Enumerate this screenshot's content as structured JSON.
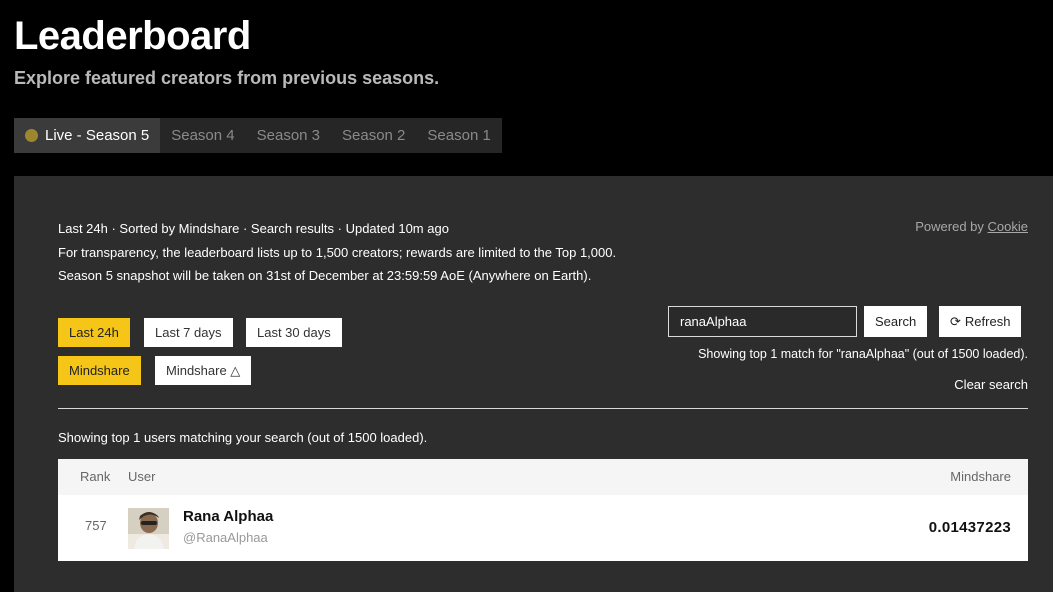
{
  "header": {
    "title": "Leaderboard",
    "subtitle": "Explore featured creators from previous seasons."
  },
  "season_tabs": [
    {
      "label": "Live - Season 5",
      "active": true
    },
    {
      "label": "Season 4",
      "active": false
    },
    {
      "label": "Season 3",
      "active": false
    },
    {
      "label": "Season 2",
      "active": false
    },
    {
      "label": "Season 1",
      "active": false
    }
  ],
  "info": {
    "line1": "Last 24h · Sorted by Mindshare · Search results · Updated 10m ago",
    "line2": "For transparency, the leaderboard lists up to 1,500 creators; rewards are limited to the Top 1,000.",
    "line3": "Season 5 snapshot will be taken on 31st of December at 23:59:59 AoE (Anywhere on Earth)."
  },
  "powered_by": {
    "prefix": "Powered by ",
    "link": "Cookie"
  },
  "time_filters": [
    {
      "label": "Last 24h",
      "selected": true
    },
    {
      "label": "Last 7 days",
      "selected": false
    },
    {
      "label": "Last 30 days",
      "selected": false
    }
  ],
  "sort_filters": [
    {
      "label": "Mindshare",
      "selected": true
    },
    {
      "label": "Mindshare △",
      "selected": false
    }
  ],
  "search": {
    "value": "ranaAlphaa",
    "button_label": "Search",
    "refresh_label": "Refresh",
    "match_text": "Showing top 1 match for \"ranaAlphaa\" (out of 1500 loaded).",
    "clear_label": "Clear search"
  },
  "results": {
    "summary": "Showing top 1 users matching your search (out of 1500 loaded).",
    "columns": {
      "rank": "Rank",
      "user": "User",
      "mindshare": "Mindshare"
    },
    "rows": [
      {
        "rank": "757",
        "name": "Rana Alphaa",
        "handle": "@RanaAlphaa",
        "mindshare": "0.01437223"
      }
    ]
  },
  "colors": {
    "accent": "#f5c518",
    "live_dot": "#9c8730",
    "panel": "#2d2d2d"
  }
}
